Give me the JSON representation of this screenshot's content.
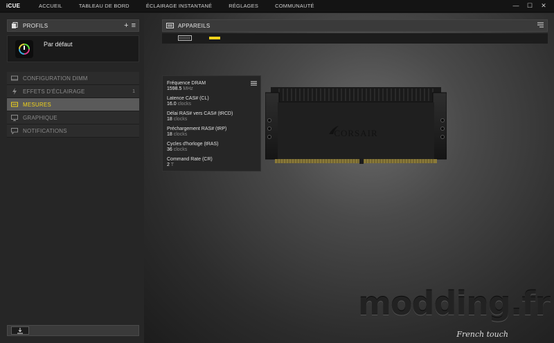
{
  "app": {
    "title": "iCUE"
  },
  "nav": [
    {
      "label": "ACCUEIL"
    },
    {
      "label": "TABLEAU DE BORD"
    },
    {
      "label": "ÉCLAIRAGE INSTANTANÉ"
    },
    {
      "label": "RÉGLAGES"
    },
    {
      "label": "COMMUNAUTÉ"
    }
  ],
  "window_controls": {
    "minimize": "—",
    "maximize": "☐",
    "close": "✕"
  },
  "profiles": {
    "header": "PROFILS",
    "add": "+",
    "menu": "≡",
    "current": "Par défaut"
  },
  "menu": [
    {
      "label": "CONFIGURATION DIMM",
      "icon": "memory-icon",
      "count": ""
    },
    {
      "label": "EFFETS D'ÉCLAIRAGE",
      "icon": "lightning-icon",
      "count": "1"
    },
    {
      "label": "MESURES",
      "icon": "gauge-icon",
      "count": ""
    },
    {
      "label": "GRAPHIQUE",
      "icon": "chart-icon",
      "count": ""
    },
    {
      "label": "NOTIFICATIONS",
      "icon": "notification-icon",
      "count": ""
    }
  ],
  "devices": {
    "header": "APPAREILS"
  },
  "measures": [
    {
      "name": "Fréquence DRAM",
      "value": "1598.5",
      "unit": "MHz"
    },
    {
      "name": "Latence CAS# (CL)",
      "value": "16.0",
      "unit": "clocks"
    },
    {
      "name": "Délai RAS# vers CAS# (tRCD)",
      "value": "18",
      "unit": "clocks"
    },
    {
      "name": "Préchargement RAS# (tRP)",
      "value": "18",
      "unit": "clocks"
    },
    {
      "name": "Cycles d'horloge (tRAS)",
      "value": "36",
      "unit": "clocks"
    },
    {
      "name": "Command Rate (CR)",
      "value": "2",
      "unit": "T"
    }
  ],
  "ram": {
    "brand": "CORSAIR"
  },
  "watermark": {
    "main": "modding.fr",
    "sub": "French touch"
  },
  "colors": {
    "accent": "#f0d21b",
    "active_bg": "#5a5a5a"
  }
}
